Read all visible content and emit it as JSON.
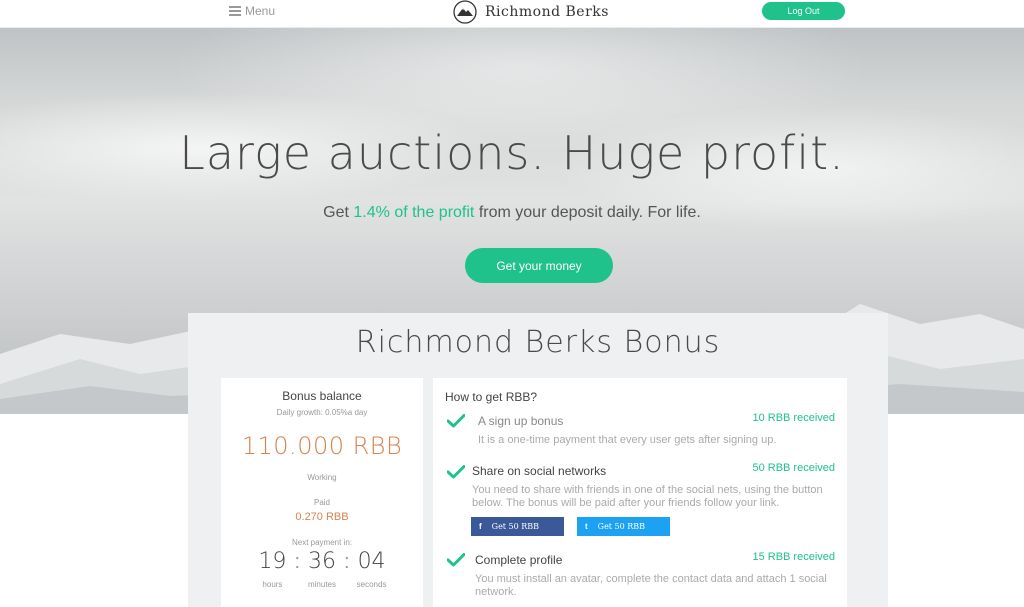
{
  "header": {
    "menu_label": "Menu",
    "brand": "Richmond Berks",
    "logout_label": "Log Out"
  },
  "hero": {
    "title": "Large auctions. Huge profit.",
    "subtitle_prefix": "Get ",
    "subtitle_accent": "1.4% of the profit",
    "subtitle_suffix": " from your deposit daily. For life.",
    "cta_label": "Get your money"
  },
  "bonus": {
    "title": "Richmond Berks Bonus",
    "balance": {
      "title": "Bonus balance",
      "growth": "Daily growth: 0.05%a day",
      "amount": "110.000 RBB",
      "status": "Working",
      "paid_label": "Paid",
      "paid_value": "0.270 RBB",
      "next_label": "Next payment in:",
      "timer": {
        "hours": "19",
        "minutes": "36",
        "seconds": "04",
        "sep": ":",
        "hours_label": "hours",
        "minutes_label": "minutes",
        "seconds_label": "seconds"
      }
    },
    "how": {
      "title": "How to get RBB?",
      "items": [
        {
          "title": "A sign up bonus",
          "reward": "10 RBB received",
          "desc": "It is a one-time payment that every user gets after signing up."
        },
        {
          "title": "Share on social networks",
          "reward": "50 RBB received",
          "desc": "You need to share with friends in one of the social nets, using the button below. The bonus will be paid after your friends follow your link.",
          "buttons": [
            {
              "icon": "f",
              "label": "Get  50 RBB"
            },
            {
              "icon": "t",
              "label": "Get  50 RBB"
            }
          ]
        },
        {
          "title": "Complete profile",
          "reward": "15 RBB received",
          "desc": "You must install an avatar, complete the contact data and attach 1 social network."
        }
      ]
    }
  },
  "colors": {
    "accent": "#1fc28a",
    "amount": "#d6844f",
    "facebook": "#3b5998",
    "twitter": "#1da1f2"
  }
}
